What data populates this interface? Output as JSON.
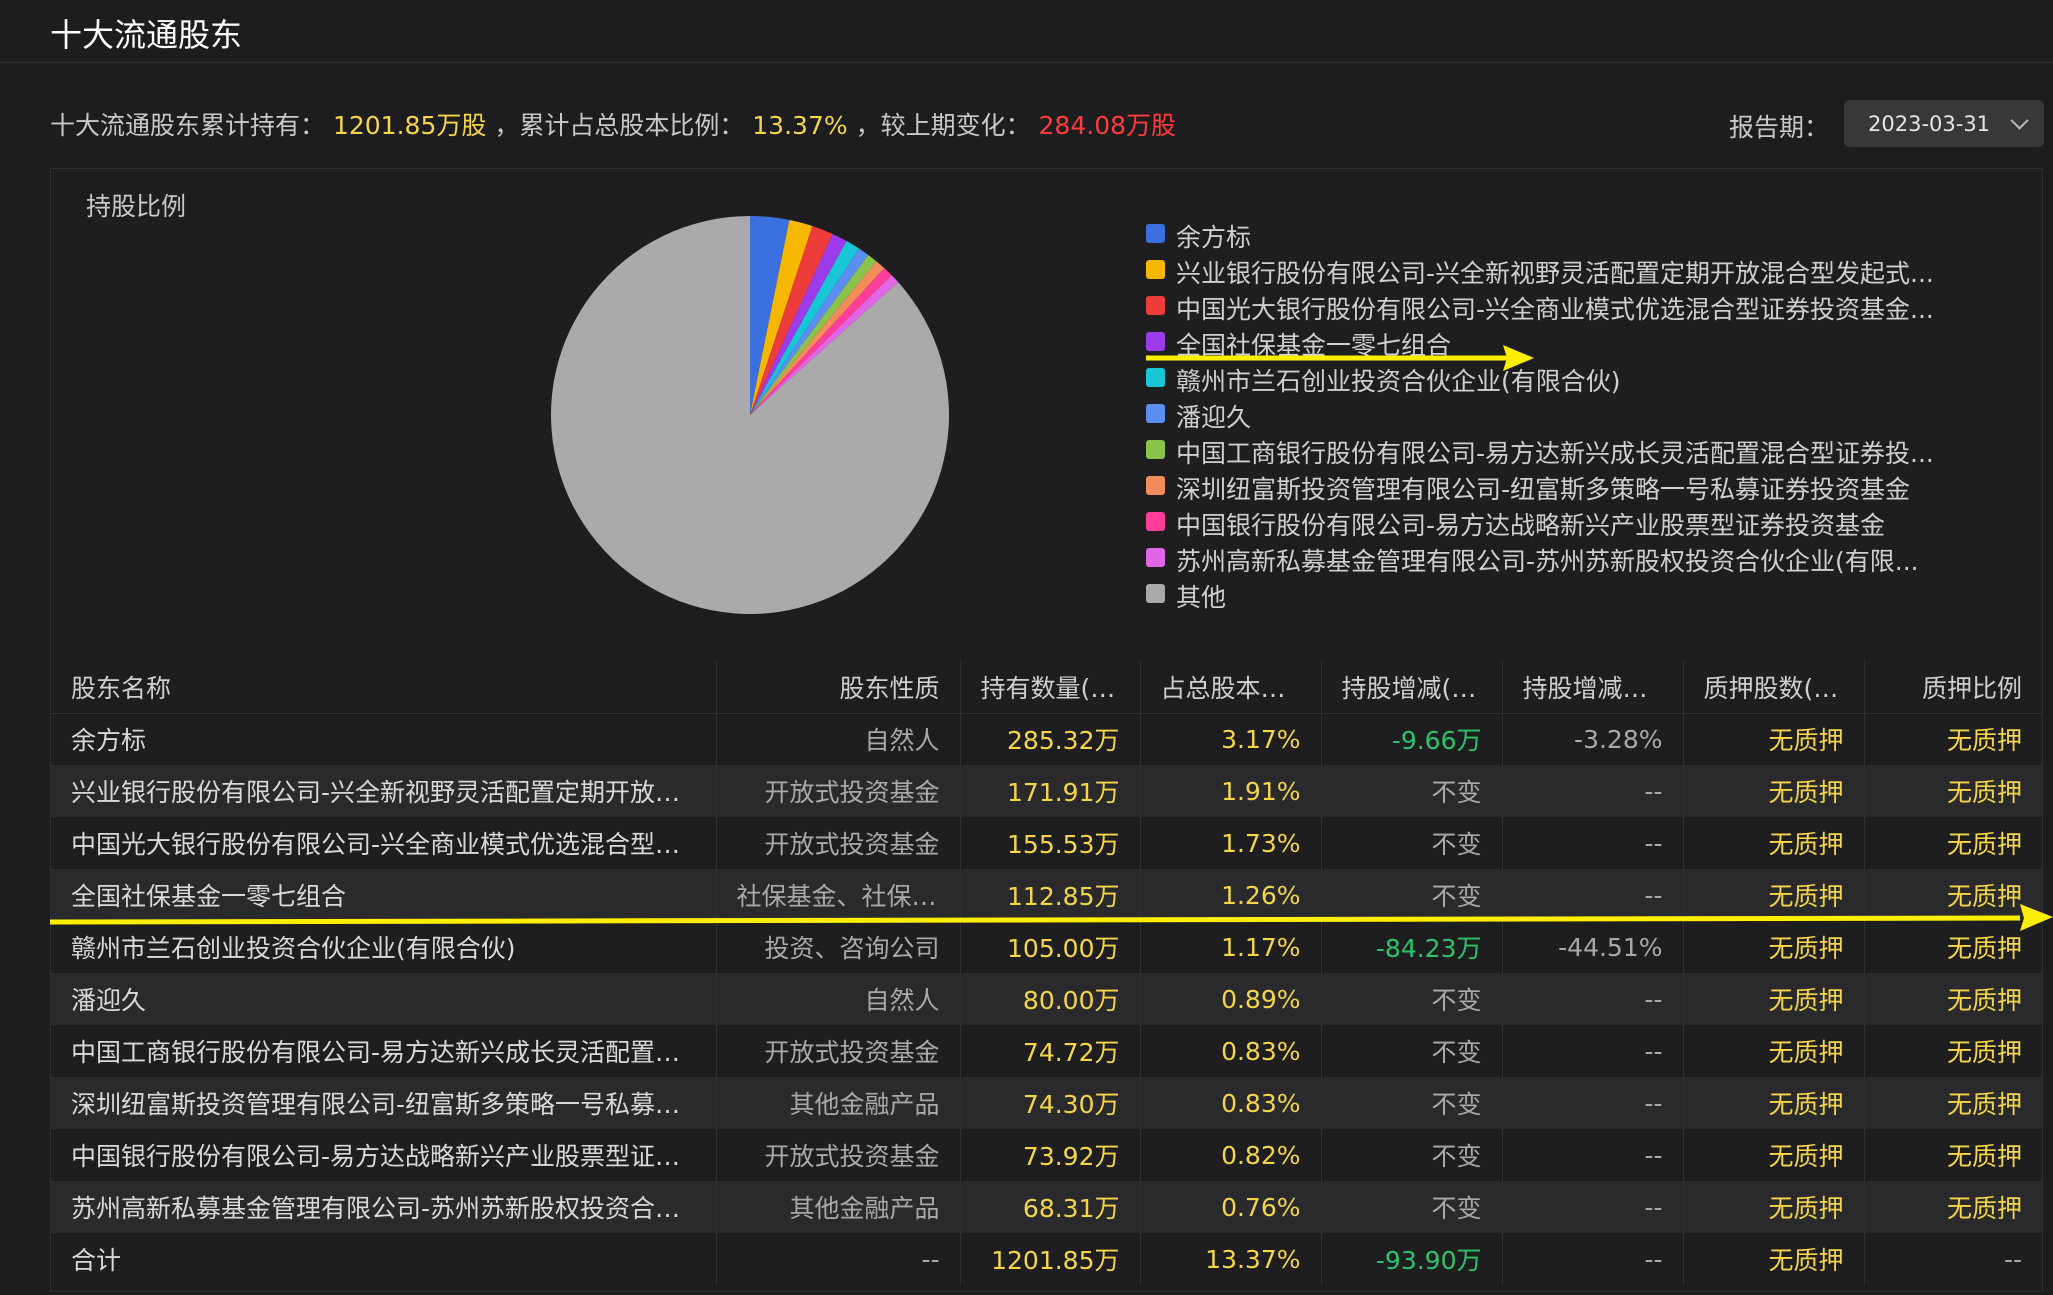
{
  "header": {
    "title": "十大流通股东"
  },
  "summary": {
    "holding_label": "十大流通股东累计持有：",
    "holding_value": "1201.85万股",
    "ratio_label": "，累计占总股本比例：",
    "ratio_value": "13.37%",
    "change_label": "，较上期变化：",
    "change_value": "284.08万股"
  },
  "period": {
    "label": "报告期：",
    "value": "2023-03-31"
  },
  "chart": {
    "title": "持股比例"
  },
  "chart_data": {
    "type": "pie",
    "title": "持股比例",
    "slices": [
      {
        "name": "余方标",
        "value": 3.17,
        "color": "#3b6fe0"
      },
      {
        "name": "兴业银行股份有限公司-兴全新视野灵活配置定期开放混合型发起式...",
        "value": 1.91,
        "color": "#f5b700"
      },
      {
        "name": "中国光大银行股份有限公司-兴全商业模式优选混合型证券投资基金...",
        "value": 1.73,
        "color": "#ee3b3b"
      },
      {
        "name": "全国社保基金一零七组合",
        "value": 1.26,
        "color": "#9b3bea"
      },
      {
        "name": "赣州市兰石创业投资合伙企业(有限合伙)",
        "value": 1.17,
        "color": "#18c6d8"
      },
      {
        "name": "潘迎久",
        "value": 0.89,
        "color": "#5b8ef0"
      },
      {
        "name": "中国工商银行股份有限公司-易方达新兴成长灵活配置混合型证券投...",
        "value": 0.83,
        "color": "#8bc34a"
      },
      {
        "name": "深圳纽富斯投资管理有限公司-纽富斯多策略一号私募证券投资基金",
        "value": 0.83,
        "color": "#f28c5a"
      },
      {
        "name": "中国银行股份有限公司-易方达战略新兴产业股票型证券投资基金",
        "value": 0.82,
        "color": "#ff3d9a"
      },
      {
        "name": "苏州高新私募基金管理有限公司-苏州苏新股权投资合伙企业(有限...",
        "value": 0.76,
        "color": "#e066e6"
      },
      {
        "name": "其他",
        "value": 86.63,
        "color": "#aaaaaa"
      }
    ]
  },
  "table": {
    "headers": [
      "股东名称",
      "股东性质",
      "持有数量(股)",
      "占总股本比例",
      "持股增减(股)",
      "持股增减幅度",
      "质押股数(股)",
      "质押比例"
    ],
    "rows": [
      [
        "余方标",
        "自然人",
        "285.32万",
        "3.17%",
        "-9.66万",
        "-3.28%",
        "无质押",
        "无质押"
      ],
      [
        "兴业银行股份有限公司-兴全新视野灵活配置定期开放混合...",
        "开放式投资基金",
        "171.91万",
        "1.91%",
        "不变",
        "--",
        "无质押",
        "无质押"
      ],
      [
        "中国光大银行股份有限公司-兴全商业模式优选混合型证券...",
        "开放式投资基金",
        "155.53万",
        "1.73%",
        "不变",
        "--",
        "无质押",
        "无质押"
      ],
      [
        "全国社保基金一零七组合",
        "社保基金、社保机...",
        "112.85万",
        "1.26%",
        "不变",
        "--",
        "无质押",
        "无质押"
      ],
      [
        "赣州市兰石创业投资合伙企业(有限合伙)",
        "投资、咨询公司",
        "105.00万",
        "1.17%",
        "-84.23万",
        "-44.51%",
        "无质押",
        "无质押"
      ],
      [
        "潘迎久",
        "自然人",
        "80.00万",
        "0.89%",
        "不变",
        "--",
        "无质押",
        "无质押"
      ],
      [
        "中国工商银行股份有限公司-易方达新兴成长灵活配置混合...",
        "开放式投资基金",
        "74.72万",
        "0.83%",
        "不变",
        "--",
        "无质押",
        "无质押"
      ],
      [
        "深圳纽富斯投资管理有限公司-纽富斯多策略一号私募证券...",
        "其他金融产品",
        "74.30万",
        "0.83%",
        "不变",
        "--",
        "无质押",
        "无质押"
      ],
      [
        "中国银行股份有限公司-易方达战略新兴产业股票型证券投...",
        "开放式投资基金",
        "73.92万",
        "0.82%",
        "不变",
        "--",
        "无质押",
        "无质押"
      ],
      [
        "苏州高新私募基金管理有限公司-苏州苏新股权投资合伙企...",
        "其他金融产品",
        "68.31万",
        "0.76%",
        "不变",
        "--",
        "无质押",
        "无质押"
      ],
      [
        "合计",
        "--",
        "1201.85万",
        "13.37%",
        "-93.90万",
        "--",
        "无质押",
        "--"
      ]
    ]
  },
  "colors": {
    "yellow": "#f5d64a",
    "red": "#ff3b3b",
    "green": "#2ec26b",
    "annotation": "#ffee00"
  }
}
